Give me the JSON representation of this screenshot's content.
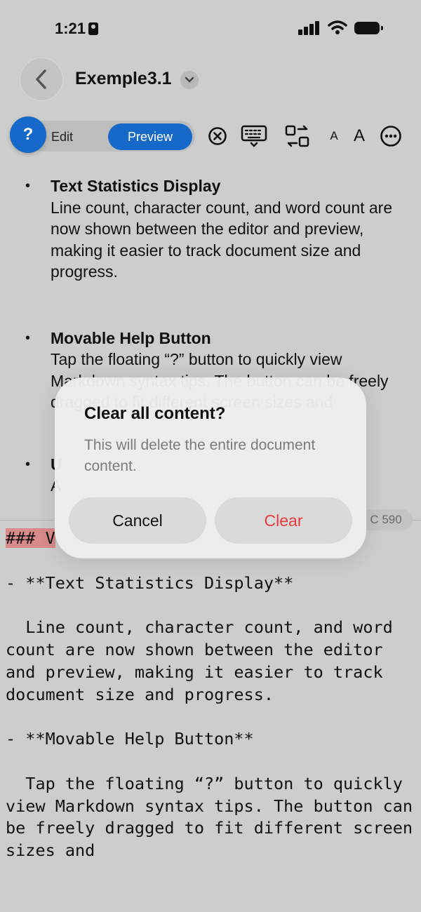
{
  "status_bar": {
    "time": "1:21"
  },
  "nav": {
    "title": "Exemple3.1"
  },
  "toolbar": {
    "help_label": "?",
    "edit_label": "Edit",
    "preview_label": "Preview",
    "small_font_label": "A",
    "large_font_label": "A"
  },
  "preview": {
    "items": [
      {
        "heading": "Text Statistics Display",
        "body": "Line count, character count, and word count are now shown between the editor and preview, making it easier to track document size and progress."
      },
      {
        "heading": "Movable Help Button",
        "body": "Tap the floating “?” button to quickly view Markdown syntax tips. The button can be freely dragged to fit different screen sizes and"
      },
      {
        "heading": "U",
        "body": "A"
      }
    ]
  },
  "stats": {
    "chars": "C 590"
  },
  "editor": {
    "heading_line": "### V",
    "lines": [
      "",
      "- **Text Statistics Display**",
      "",
      "  Line count, character count, and word count are now shown between the editor and preview, making it easier to track document size and progress.",
      "",
      "- **Movable Help Button**",
      "",
      "  Tap the floating “?” button to quickly view Markdown syntax tips. The button can be freely dragged to fit different screen sizes and"
    ]
  },
  "dialog": {
    "title": "Clear all content?",
    "message": "This will delete the entire document content.",
    "cancel_label": "Cancel",
    "clear_label": "Clear"
  },
  "colors": {
    "accent": "#1769c9",
    "destructive": "#e63b3b",
    "highlight": "#d98a8a"
  }
}
